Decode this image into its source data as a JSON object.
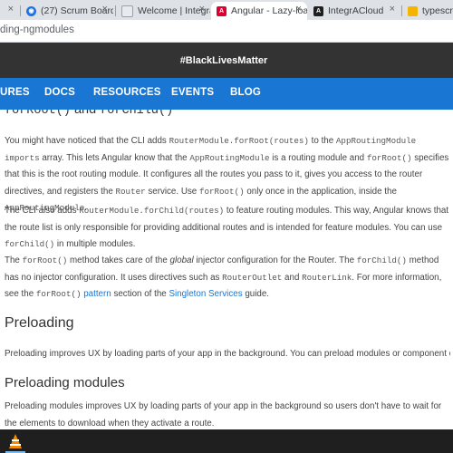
{
  "tabs": [
    {
      "title": "(27) Scrum Board",
      "icon": "chat-icon"
    },
    {
      "title": "Welcome | Integra",
      "icon": "page-icon"
    },
    {
      "title": "Angular - Lazy-loa",
      "icon": "angular-icon"
    },
    {
      "title": "IntegrACloud",
      "icon": "angular-icon"
    },
    {
      "title": "typescript",
      "icon": "typescript-icon"
    }
  ],
  "tab_close": "×",
  "url": "ding-ngmodules",
  "banner": "#BlackLivesMatter",
  "nav": [
    "URES",
    "DOCS",
    "RESOURCES",
    "EVENTS",
    "BLOG"
  ],
  "content": {
    "partial_heading": {
      "code1": "forRoot()",
      "and": " and ",
      "code2": "forChild()"
    },
    "p1": {
      "t1": "You might have noticed that the CLI adds ",
      "c1": "RouterModule.forRoot(routes)",
      "t2": " to the ",
      "c2": "AppRoutingModule",
      "t3": " ",
      "c3": "imports",
      "t4": " array. This lets Angular know that the ",
      "c4": "AppRoutingModule",
      "t5": " is a routing module and ",
      "c5": "forRoot()",
      "t6": " specifies that this is the root routing module. It configures all the routes you pass to it, gives you access to the router directives, and registers the ",
      "c6": "Router",
      "t7": " service. Use ",
      "c7": "forRoot()",
      "t8": " only once in the application, inside the ",
      "c8": "AppRoutingModule",
      "t9": "."
    },
    "p2": {
      "t1": "The CLI also adds ",
      "c1": "RouterModule.forChild(routes)",
      "t2": " to feature routing modules. This way, Angular knows that the route list is only responsible for providing additional routes and is intended for feature modules. You can use ",
      "c2": "forChild()",
      "t3": " in multiple modules."
    },
    "p3": {
      "t1": "The ",
      "c1": "forRoot()",
      "t2": " method takes care of the ",
      "em": "global",
      "t3": " injector configuration for the Router. The ",
      "c2": "forChild()",
      "t4": " method has no injector configuration. It uses directives such as ",
      "c3": "RouterOutlet",
      "t5": " and ",
      "c4": "RouterLink",
      "t6": ". For more information, see the ",
      "c5": "forRoot()",
      "t7": " ",
      "link1": "pattern",
      "t8": " section of the ",
      "link2": "Singleton Services",
      "t9": " guide."
    },
    "h_preloading": "Preloading",
    "p4": "Preloading improves UX by loading parts of your app in the background. You can preload modules or component data.",
    "h_preloading_modules": "Preloading modules",
    "p5": "Preloading modules improves UX by loading parts of your app in the background so users don't have to wait for the elements to download when they activate a route."
  },
  "colors": {
    "banner_bg": "#333333",
    "nav_bg": "#1976d2",
    "link": "#1976d2"
  }
}
